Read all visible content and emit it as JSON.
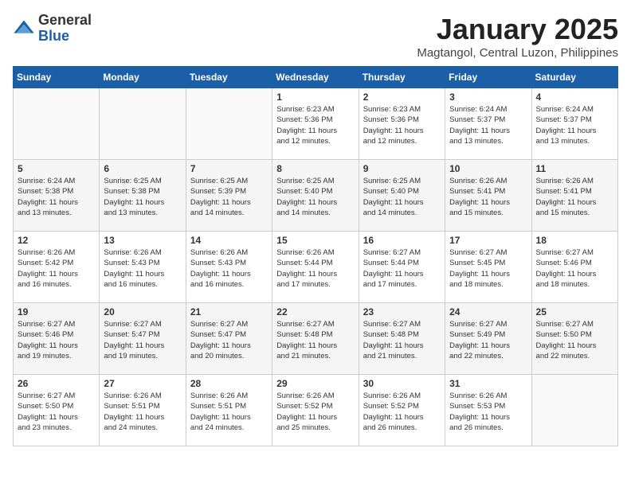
{
  "logo": {
    "general": "General",
    "blue": "Blue"
  },
  "title": "January 2025",
  "subtitle": "Magtangol, Central Luzon, Philippines",
  "weekdays": [
    "Sunday",
    "Monday",
    "Tuesday",
    "Wednesday",
    "Thursday",
    "Friday",
    "Saturday"
  ],
  "weeks": [
    [
      {
        "day": "",
        "info": ""
      },
      {
        "day": "",
        "info": ""
      },
      {
        "day": "",
        "info": ""
      },
      {
        "day": "1",
        "info": "Sunrise: 6:23 AM\nSunset: 5:36 PM\nDaylight: 11 hours\nand 12 minutes."
      },
      {
        "day": "2",
        "info": "Sunrise: 6:23 AM\nSunset: 5:36 PM\nDaylight: 11 hours\nand 12 minutes."
      },
      {
        "day": "3",
        "info": "Sunrise: 6:24 AM\nSunset: 5:37 PM\nDaylight: 11 hours\nand 13 minutes."
      },
      {
        "day": "4",
        "info": "Sunrise: 6:24 AM\nSunset: 5:37 PM\nDaylight: 11 hours\nand 13 minutes."
      }
    ],
    [
      {
        "day": "5",
        "info": "Sunrise: 6:24 AM\nSunset: 5:38 PM\nDaylight: 11 hours\nand 13 minutes."
      },
      {
        "day": "6",
        "info": "Sunrise: 6:25 AM\nSunset: 5:38 PM\nDaylight: 11 hours\nand 13 minutes."
      },
      {
        "day": "7",
        "info": "Sunrise: 6:25 AM\nSunset: 5:39 PM\nDaylight: 11 hours\nand 14 minutes."
      },
      {
        "day": "8",
        "info": "Sunrise: 6:25 AM\nSunset: 5:40 PM\nDaylight: 11 hours\nand 14 minutes."
      },
      {
        "day": "9",
        "info": "Sunrise: 6:25 AM\nSunset: 5:40 PM\nDaylight: 11 hours\nand 14 minutes."
      },
      {
        "day": "10",
        "info": "Sunrise: 6:26 AM\nSunset: 5:41 PM\nDaylight: 11 hours\nand 15 minutes."
      },
      {
        "day": "11",
        "info": "Sunrise: 6:26 AM\nSunset: 5:41 PM\nDaylight: 11 hours\nand 15 minutes."
      }
    ],
    [
      {
        "day": "12",
        "info": "Sunrise: 6:26 AM\nSunset: 5:42 PM\nDaylight: 11 hours\nand 16 minutes."
      },
      {
        "day": "13",
        "info": "Sunrise: 6:26 AM\nSunset: 5:43 PM\nDaylight: 11 hours\nand 16 minutes."
      },
      {
        "day": "14",
        "info": "Sunrise: 6:26 AM\nSunset: 5:43 PM\nDaylight: 11 hours\nand 16 minutes."
      },
      {
        "day": "15",
        "info": "Sunrise: 6:26 AM\nSunset: 5:44 PM\nDaylight: 11 hours\nand 17 minutes."
      },
      {
        "day": "16",
        "info": "Sunrise: 6:27 AM\nSunset: 5:44 PM\nDaylight: 11 hours\nand 17 minutes."
      },
      {
        "day": "17",
        "info": "Sunrise: 6:27 AM\nSunset: 5:45 PM\nDaylight: 11 hours\nand 18 minutes."
      },
      {
        "day": "18",
        "info": "Sunrise: 6:27 AM\nSunset: 5:46 PM\nDaylight: 11 hours\nand 18 minutes."
      }
    ],
    [
      {
        "day": "19",
        "info": "Sunrise: 6:27 AM\nSunset: 5:46 PM\nDaylight: 11 hours\nand 19 minutes."
      },
      {
        "day": "20",
        "info": "Sunrise: 6:27 AM\nSunset: 5:47 PM\nDaylight: 11 hours\nand 19 minutes."
      },
      {
        "day": "21",
        "info": "Sunrise: 6:27 AM\nSunset: 5:47 PM\nDaylight: 11 hours\nand 20 minutes."
      },
      {
        "day": "22",
        "info": "Sunrise: 6:27 AM\nSunset: 5:48 PM\nDaylight: 11 hours\nand 21 minutes."
      },
      {
        "day": "23",
        "info": "Sunrise: 6:27 AM\nSunset: 5:48 PM\nDaylight: 11 hours\nand 21 minutes."
      },
      {
        "day": "24",
        "info": "Sunrise: 6:27 AM\nSunset: 5:49 PM\nDaylight: 11 hours\nand 22 minutes."
      },
      {
        "day": "25",
        "info": "Sunrise: 6:27 AM\nSunset: 5:50 PM\nDaylight: 11 hours\nand 22 minutes."
      }
    ],
    [
      {
        "day": "26",
        "info": "Sunrise: 6:27 AM\nSunset: 5:50 PM\nDaylight: 11 hours\nand 23 minutes."
      },
      {
        "day": "27",
        "info": "Sunrise: 6:26 AM\nSunset: 5:51 PM\nDaylight: 11 hours\nand 24 minutes."
      },
      {
        "day": "28",
        "info": "Sunrise: 6:26 AM\nSunset: 5:51 PM\nDaylight: 11 hours\nand 24 minutes."
      },
      {
        "day": "29",
        "info": "Sunrise: 6:26 AM\nSunset: 5:52 PM\nDaylight: 11 hours\nand 25 minutes."
      },
      {
        "day": "30",
        "info": "Sunrise: 6:26 AM\nSunset: 5:52 PM\nDaylight: 11 hours\nand 26 minutes."
      },
      {
        "day": "31",
        "info": "Sunrise: 6:26 AM\nSunset: 5:53 PM\nDaylight: 11 hours\nand 26 minutes."
      },
      {
        "day": "",
        "info": ""
      }
    ]
  ]
}
